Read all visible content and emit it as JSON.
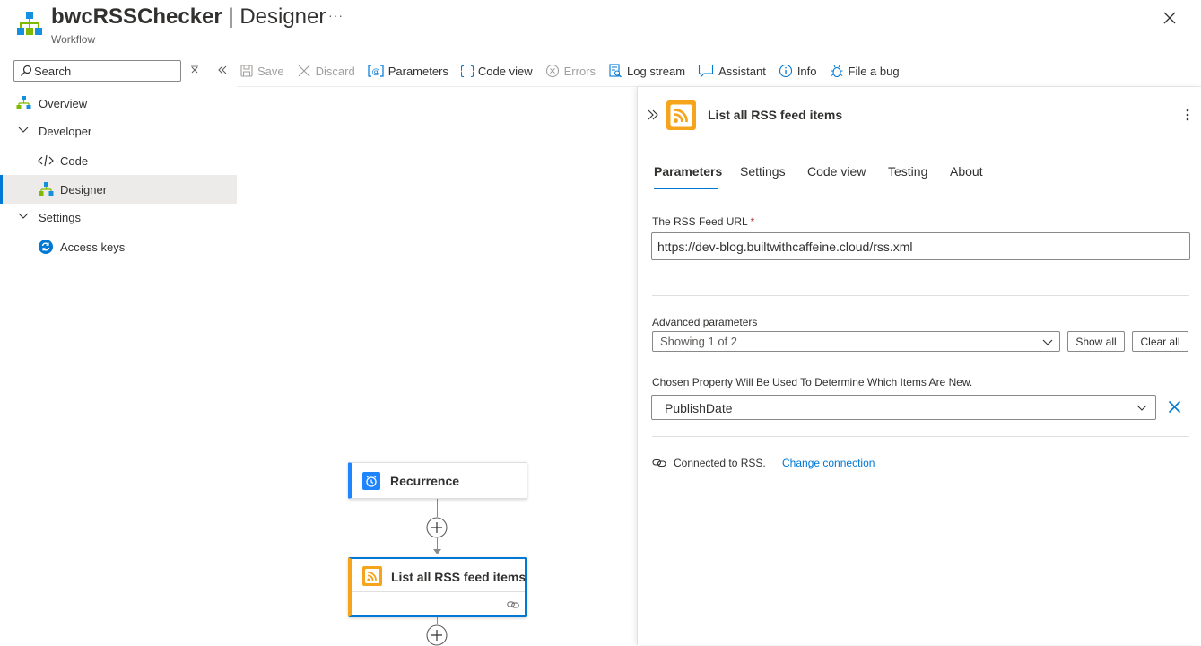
{
  "header": {
    "title_bold": "bwcRSSChecker",
    "title_rest": " | Designer",
    "subtitle": "Workflow",
    "more_label": "···"
  },
  "search": {
    "placeholder": "Search"
  },
  "toolbar": {
    "save": "Save",
    "discard": "Discard",
    "parameters": "Parameters",
    "code_view": "Code view",
    "errors": "Errors",
    "log_stream": "Log stream",
    "assistant": "Assistant",
    "info": "Info",
    "file_bug": "File a bug"
  },
  "sidebar": {
    "overview": "Overview",
    "developer": "Developer",
    "code": "Code",
    "designer": "Designer",
    "settings": "Settings",
    "access_keys": "Access keys"
  },
  "canvas": {
    "recurrence": "Recurrence",
    "rss_action": "List all RSS feed items"
  },
  "panel": {
    "title": "List all RSS feed items",
    "tabs": [
      "Parameters",
      "Settings",
      "Code view",
      "Testing",
      "About"
    ],
    "url_label": "The RSS Feed URL",
    "required_mark": "*",
    "url_value": "https://dev-blog.builtwithcaffeine.cloud/rss.xml",
    "advanced_label": "Advanced parameters",
    "advanced_value": "Showing 1 of 2",
    "show_all": "Show all",
    "clear_all": "Clear all",
    "chosen_label": "Chosen Property Will Be Used To Determine Which Items Are New.",
    "chosen_value": "PublishDate",
    "connected_text": "Connected to RSS.",
    "change_connection": "Change connection"
  },
  "colors": {
    "accent": "#0078d4",
    "rss_orange": "#f7a41d",
    "recurrence_blue": "#1f85ff"
  },
  "icons": [
    "workflow-icon",
    "search-icon",
    "close-icon",
    "collapse-icon",
    "save-icon",
    "discard-icon",
    "parameters-icon",
    "code-view-icon",
    "errors-icon",
    "log-stream-icon",
    "assistant-icon",
    "info-icon",
    "bug-icon",
    "rss-icon",
    "clock-icon",
    "plus-icon",
    "link-icon",
    "chevron-down-icon",
    "kebab-icon",
    "expand-icon",
    "access-keys-icon"
  ]
}
